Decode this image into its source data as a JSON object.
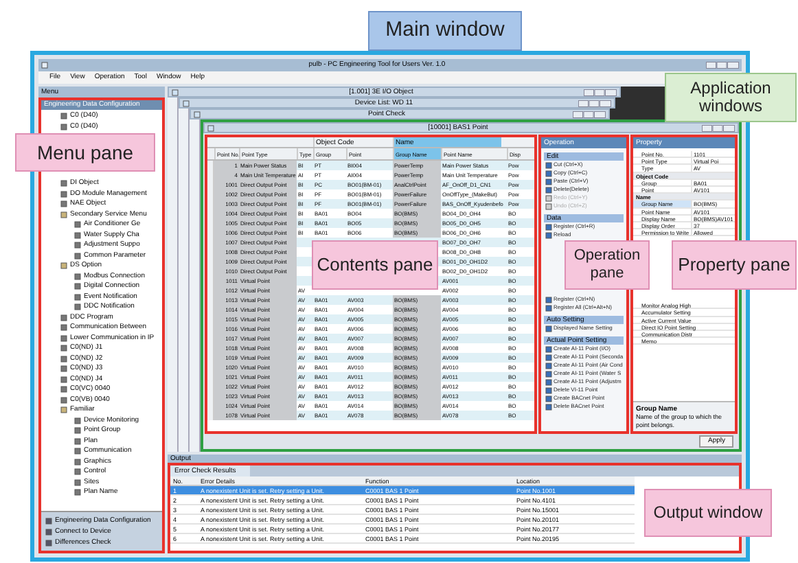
{
  "callouts": [
    {
      "label": "Main window",
      "kind": "main"
    },
    {
      "label": "Application windows",
      "kind": "app"
    },
    {
      "label": "Menu pane",
      "kind": "pane"
    },
    {
      "label": "Contents pane",
      "kind": "pane"
    },
    {
      "label": "Operation pane",
      "kind": "pane"
    },
    {
      "label": "Property pane",
      "kind": "pane"
    },
    {
      "label": "Output window",
      "kind": "pane"
    }
  ],
  "window": {
    "title": "pulb - PC Engineering Tool for Users Ver. 1.0",
    "menu": [
      "File",
      "View",
      "Operation",
      "Tool",
      "Window",
      "Help"
    ]
  },
  "menu_pane": {
    "header": "Menu",
    "section": "Engineering Data Configuration",
    "tree": [
      {
        "label": "C0 (D40)"
      },
      {
        "label": "C0 (D40)"
      },
      {
        "label": "DI Object"
      },
      {
        "label": "DO Module Management"
      },
      {
        "label": "NAE Object"
      },
      {
        "label": "Secondary Service Menu",
        "children": [
          {
            "label": "Air Conditioner Ge"
          },
          {
            "label": "Water Supply Cha"
          },
          {
            "label": "Adjustment Suppo"
          },
          {
            "label": "Common Parameter"
          }
        ]
      },
      {
        "label": "DS Option",
        "children": [
          {
            "label": "Modbus Connection"
          },
          {
            "label": "Digital Connection"
          },
          {
            "label": "Event Notification"
          },
          {
            "label": "DDC Notification"
          }
        ]
      },
      {
        "label": "DDC Program"
      },
      {
        "label": "Communication Between"
      },
      {
        "label": "Lower Communication in IP"
      },
      {
        "label": "C0(ND) J1"
      },
      {
        "label": "C0(ND) J2"
      },
      {
        "label": "C0(ND) J3"
      },
      {
        "label": "C0(ND) J4"
      },
      {
        "label": "C0(VC) 0040"
      },
      {
        "label": "C0(VB) 0040"
      },
      {
        "label": "Familiar",
        "children": [
          {
            "label": "Device Monitoring"
          },
          {
            "label": "Point Group"
          },
          {
            "label": "Plan"
          },
          {
            "label": "Communication"
          },
          {
            "label": "Graphics"
          },
          {
            "label": "Control"
          },
          {
            "label": "Sites"
          },
          {
            "label": "Plan Name"
          }
        ]
      }
    ],
    "footer": [
      "Engineering Data Configuration",
      "Connect to Device",
      "Differences Check"
    ]
  },
  "app_windows": [
    {
      "title": "[1.001] 3E I/O Object"
    },
    {
      "title": "Device List: WD 11"
    },
    {
      "title": "Point Check"
    },
    {
      "title": "[10001] BAS1 Point"
    }
  ],
  "contents": {
    "group_headers": [
      {
        "label": "Object Code",
        "selected": false
      },
      {
        "label": "Name",
        "selected": true
      }
    ],
    "columns": [
      "Point No.",
      "Point Type",
      "Type",
      "Group",
      "Point",
      "Group Name",
      "Point Name",
      "Disp"
    ],
    "rows": [
      {
        "point_no": "1",
        "point_type": "Main Power Status",
        "type": "BI",
        "group": "PT",
        "point": "BI004",
        "group_name": "PowerTemp",
        "point_name": "Main Power Status",
        "disp": "Pow"
      },
      {
        "point_no": "4",
        "point_type": "Main Unit Temperature",
        "type": "AI",
        "group": "PT",
        "point": "AI004",
        "group_name": "PowerTemp",
        "point_name": "Main Unit Temperature",
        "disp": "Pow"
      },
      {
        "point_no": "1001",
        "point_type": "Direct Output Point",
        "type": "BI",
        "group": "PC",
        "point": "BO01(BM-01)",
        "group_name": "AnalCtrlPoint",
        "point_name": "AF_OnOff_D1_CN1",
        "disp": "Pow"
      },
      {
        "point_no": "1002",
        "point_type": "Direct Output Point",
        "type": "BI",
        "group": "PF",
        "point": "BO01(BM-01)",
        "group_name": "PowerFailure",
        "point_name": "OnOffType_(MakeBut)",
        "disp": "Pow"
      },
      {
        "point_no": "1003",
        "point_type": "Direct Output Point",
        "type": "BI",
        "group": "PF",
        "point": "BO01(BM-01)",
        "group_name": "PowerFailure",
        "point_name": "BAS_OnOff_Kyudenbefo",
        "disp": "Pow"
      },
      {
        "point_no": "1004",
        "point_type": "Direct Output Point",
        "type": "BI",
        "group": "BA01",
        "point": "BO04",
        "group_name": "BO(BMS)",
        "point_name": "BO04_D0_OH4",
        "disp": "BO"
      },
      {
        "point_no": "1005",
        "point_type": "Direct Output Point",
        "type": "BI",
        "group": "BA01",
        "point": "BO05",
        "group_name": "BO(BMS)",
        "point_name": "BO05_D0_OH5",
        "disp": "BO"
      },
      {
        "point_no": "1006",
        "point_type": "Direct Output Point",
        "type": "BI",
        "group": "BA01",
        "point": "BO06",
        "group_name": "BO(BMS)",
        "point_name": "BO06_D0_OH6",
        "disp": "BO"
      },
      {
        "point_no": "1007",
        "point_type": "Direct Output Point",
        "point_name": "BO07_D0_OH7",
        "disp": "BO"
      },
      {
        "point_no": "1008",
        "point_type": "Direct Output Point",
        "point_name": "BO08_D0_OH8",
        "disp": "BO"
      },
      {
        "point_no": "1009",
        "point_type": "Direct Output Point",
        "point_name": "BO01_D0_OH1D2",
        "disp": "BO"
      },
      {
        "point_no": "1010",
        "point_type": "Direct Output Point",
        "point_name": "BO02_D0_OH1D2",
        "disp": "BO"
      },
      {
        "point_no": "1011",
        "point_type": "Virtual Point",
        "point_name": "AV001",
        "disp": "BO"
      },
      {
        "point_no": "1012",
        "point_type": "Virtual Point",
        "type": "AV",
        "point_name": "AV002",
        "disp": "BO"
      },
      {
        "point_no": "1013",
        "point_type": "Virtual Point",
        "type": "AV",
        "group": "BA01",
        "point": "AV003",
        "group_name": "BO(BMS)",
        "point_name": "AV003",
        "disp": "BO"
      },
      {
        "point_no": "1014",
        "point_type": "Virtual Point",
        "type": "AV",
        "group": "BA01",
        "point": "AV004",
        "group_name": "BO(BMS)",
        "point_name": "AV004",
        "disp": "BO"
      },
      {
        "point_no": "1015",
        "point_type": "Virtual Point",
        "type": "AV",
        "group": "BA01",
        "point": "AV005",
        "group_name": "BO(BMS)",
        "point_name": "AV005",
        "disp": "BO"
      },
      {
        "point_no": "1016",
        "point_type": "Virtual Point",
        "type": "AV",
        "group": "BA01",
        "point": "AV006",
        "group_name": "BO(BMS)",
        "point_name": "AV006",
        "disp": "BO"
      },
      {
        "point_no": "1017",
        "point_type": "Virtual Point",
        "type": "AV",
        "group": "BA01",
        "point": "AV007",
        "group_name": "BO(BMS)",
        "point_name": "AV007",
        "disp": "BO"
      },
      {
        "point_no": "1018",
        "point_type": "Virtual Point",
        "type": "AV",
        "group": "BA01",
        "point": "AV008",
        "group_name": "BO(BMS)",
        "point_name": "AV008",
        "disp": "BO"
      },
      {
        "point_no": "1019",
        "point_type": "Virtual Point",
        "type": "AV",
        "group": "BA01",
        "point": "AV009",
        "group_name": "BO(BMS)",
        "point_name": "AV009",
        "disp": "BO"
      },
      {
        "point_no": "1020",
        "point_type": "Virtual Point",
        "type": "AV",
        "group": "BA01",
        "point": "AV010",
        "group_name": "BO(BMS)",
        "point_name": "AV010",
        "disp": "BO"
      },
      {
        "point_no": "1021",
        "point_type": "Virtual Point",
        "type": "AV",
        "group": "BA01",
        "point": "AV011",
        "group_name": "BO(BMS)",
        "point_name": "AV011",
        "disp": "BO"
      },
      {
        "point_no": "1022",
        "point_type": "Virtual Point",
        "type": "AV",
        "group": "BA01",
        "point": "AV012",
        "group_name": "BO(BMS)",
        "point_name": "AV012",
        "disp": "BO"
      },
      {
        "point_no": "1023",
        "point_type": "Virtual Point",
        "type": "AV",
        "group": "BA01",
        "point": "AV013",
        "group_name": "BO(BMS)",
        "point_name": "AV013",
        "disp": "BO"
      },
      {
        "point_no": "1024",
        "point_type": "Virtual Point",
        "type": "AV",
        "group": "BA01",
        "point": "AV014",
        "group_name": "BO(BMS)",
        "point_name": "AV014",
        "disp": "BO"
      },
      {
        "point_no": "1078",
        "point_type": "Virtual Point",
        "type": "AV",
        "group": "BA01",
        "point": "AV078",
        "group_name": "BO(BMS)",
        "point_name": "AV078",
        "disp": "BO"
      }
    ]
  },
  "operation": {
    "header": "Operation",
    "sections": [
      {
        "title": "Edit",
        "items": [
          {
            "label": "Cut (Ctrl+X)",
            "disabled": false
          },
          {
            "label": "Copy (Ctrl+C)",
            "disabled": false
          },
          {
            "label": "Paste (Ctrl+V)",
            "disabled": false
          },
          {
            "label": "Delete(Delete)",
            "disabled": false
          },
          {
            "label": "Redo (Ctrl+Y)",
            "disabled": true
          },
          {
            "label": "Undo (Ctrl+Z)",
            "disabled": true
          }
        ]
      },
      {
        "title": "Data",
        "items": [
          {
            "label": "Register (Ctrl+R)",
            "disabled": false
          },
          {
            "label": "Reload",
            "disabled": false
          }
        ]
      },
      {
        "items": [
          {
            "label": "Register (Ctrl+N)",
            "disabled": false
          },
          {
            "label": "Register All (Ctrl+Alt+N)",
            "disabled": false
          }
        ]
      },
      {
        "title": "Auto Setting",
        "items": [
          {
            "label": "Displayed Name Setting",
            "disabled": false
          }
        ]
      },
      {
        "title": "Actual Point Setting",
        "items": [
          {
            "label": "Create AI-11 Point (I/O)",
            "disabled": false
          },
          {
            "label": "Create AI-11 Point (Seconda",
            "disabled": false
          },
          {
            "label": "Create AI-11 Point (Air Cond",
            "disabled": false
          },
          {
            "label": "Create AI-11 Point (Water S",
            "disabled": false
          },
          {
            "label": "Create AI-11 Point (Adjustm",
            "disabled": false
          },
          {
            "label": "Delete VI-11 Point",
            "disabled": false
          },
          {
            "label": "Create BACnet Point",
            "disabled": false
          },
          {
            "label": "Delete BACnet Point",
            "disabled": false
          }
        ]
      }
    ]
  },
  "property": {
    "header": "Property",
    "rows": [
      {
        "name": "Point No.",
        "value": "1101",
        "category": false,
        "selected": false
      },
      {
        "name": "Point Type",
        "value": "Virtual Poi",
        "category": false,
        "selected": false
      },
      {
        "name": "Type",
        "value": "AV",
        "category": false,
        "selected": false
      },
      {
        "name": "Object Code",
        "category": true,
        "selected": false
      },
      {
        "name": "Group",
        "value": "BA01",
        "category": false,
        "selected": false
      },
      {
        "name": "Point",
        "value": "AV101",
        "category": false,
        "selected": false
      },
      {
        "name": "Name",
        "category": true,
        "selected": false
      },
      {
        "name": "Group Name",
        "value": "BO(BMS)",
        "category": false,
        "selected": true
      },
      {
        "name": "Point Name",
        "value": "AV101",
        "category": false,
        "selected": false
      },
      {
        "name": "Display Name",
        "value": "BO(BMS)AV101",
        "category": false,
        "selected": false
      },
      {
        "name": "Display Order",
        "value": "37",
        "category": false,
        "selected": false
      },
      {
        "name": "Permission to Write",
        "value": "Allowed",
        "category": false,
        "selected": false
      }
    ],
    "more_rows": [
      {
        "name": "Monitor Analog High",
        "category": false,
        "selected": false
      },
      {
        "name": "Accumulator Setting",
        "category": false,
        "selected": false
      },
      {
        "name": "Active Current Value",
        "category": false,
        "selected": false
      },
      {
        "name": "Direct IO Point Setting",
        "category": false,
        "selected": false
      },
      {
        "name": "Communication Distr",
        "category": false,
        "selected": false
      },
      {
        "name": "Memo",
        "category": false,
        "selected": false
      }
    ],
    "help_title": "Group Name",
    "help_text": "Name of the group to which the point belongs.",
    "button": "Apply"
  },
  "output": {
    "header": "Output",
    "tab": "Error Check Results",
    "columns": [
      "No.",
      "Error Details",
      "Function",
      "Location"
    ],
    "rows": [
      {
        "cells": [
          "1",
          "A nonexistent Unit is set. Retry setting a Unit.",
          "C0001 BAS 1 Point",
          "Point No.1001"
        ],
        "selected": true
      },
      {
        "cells": [
          "2",
          "A nonexistent Unit is set. Retry setting a Unit.",
          "C0001 BAS 1 Point",
          "Point No.4101"
        ],
        "selected": false
      },
      {
        "cells": [
          "3",
          "A nonexistent Unit is set. Retry setting a Unit.",
          "C0001 BAS 1 Point",
          "Point No.15001"
        ],
        "selected": false
      },
      {
        "cells": [
          "4",
          "A nonexistent Unit is set. Retry setting a Unit.",
          "C0001 BAS 1 Point",
          "Point No.20101"
        ],
        "selected": false
      },
      {
        "cells": [
          "5",
          "A nonexistent Unit is set. Retry setting a Unit.",
          "C0001 BAS 1 Point",
          "Point No.20177"
        ],
        "selected": false
      },
      {
        "cells": [
          "6",
          "A nonexistent Unit is set. Retry setting a Unit.",
          "C0001 BAS 1 Point",
          "Point No.20195"
        ],
        "selected": false
      }
    ]
  }
}
